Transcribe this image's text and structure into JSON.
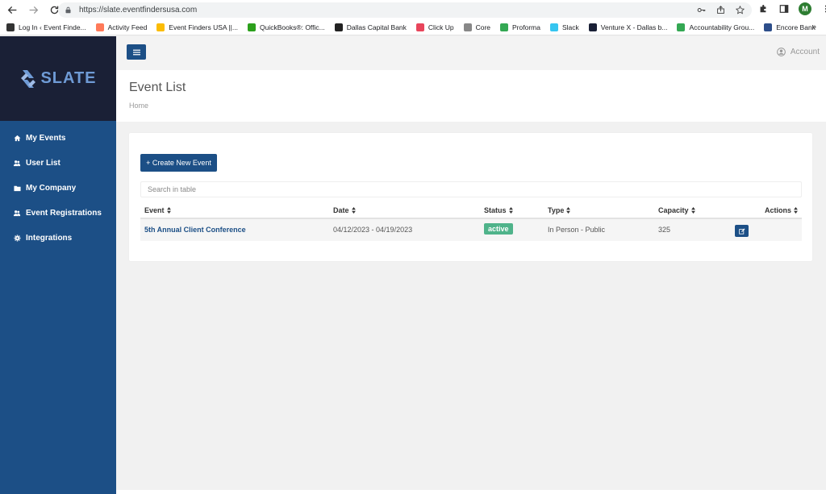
{
  "browser": {
    "url": "https://slate.eventfindersusa.com",
    "profile_initial": "M"
  },
  "bookmarks": [
    {
      "label": "Log In ‹ Event Finde...",
      "color": "#333333"
    },
    {
      "label": "Activity Feed",
      "color": "#ff7a59"
    },
    {
      "label": "Event Finders USA ||...",
      "color": "#fbbc04"
    },
    {
      "label": "QuickBooks®: Offic...",
      "color": "#2ca01c"
    },
    {
      "label": "Dallas Capital Bank",
      "color": "#222222"
    },
    {
      "label": "Click Up",
      "color": "#e8455b"
    },
    {
      "label": "Core",
      "color": "#888888"
    },
    {
      "label": "Proforma",
      "color": "#34a853"
    },
    {
      "label": "Slack",
      "color": "#36c5f0"
    },
    {
      "label": "Venture X - Dallas b...",
      "color": "#1a2036"
    },
    {
      "label": "Accountability Grou...",
      "color": "#34a853"
    },
    {
      "label": "Encore Bank",
      "color": "#2d4e8a"
    }
  ],
  "bookmarks_more": "»",
  "sidebar": {
    "logo": "SLATE",
    "items": [
      {
        "label": "My Events",
        "icon": "home-icon"
      },
      {
        "label": "User List",
        "icon": "users-icon"
      },
      {
        "label": "My Company",
        "icon": "folder-icon"
      },
      {
        "label": "Event Registrations",
        "icon": "users-icon"
      },
      {
        "label": "Integrations",
        "icon": "gear-icon"
      }
    ]
  },
  "header": {
    "account_label": "Account",
    "page_title": "Event List",
    "breadcrumb": "Home"
  },
  "main": {
    "create_button": "+ Create New Event",
    "search_placeholder": "Search in table",
    "columns": [
      "Event",
      "Date",
      "Status",
      "Type",
      "Capacity",
      "Actions"
    ],
    "rows": [
      {
        "event": "5th Annual Client Conference",
        "date": "04/12/2023 - 04/19/2023",
        "status": "active",
        "type": "In Person - Public",
        "capacity": "325"
      }
    ]
  },
  "colors": {
    "sidebar": "#1c4f86",
    "logo_bg": "#1a2036",
    "status_active": "#4fb38a",
    "link": "#1c4f86"
  }
}
